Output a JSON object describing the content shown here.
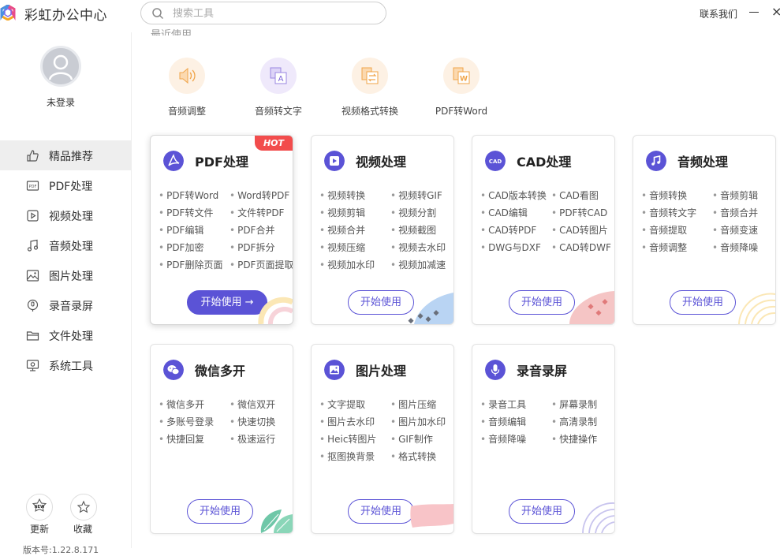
{
  "app": {
    "title": "彩虹办公中心"
  },
  "search": {
    "placeholder": "搜索工具"
  },
  "header": {
    "contact": "联系我们",
    "minimize": "—",
    "close": "×"
  },
  "user": {
    "status": "未登录"
  },
  "sidebar": {
    "items": [
      {
        "label": "精品推荐",
        "icon": "thumbs-up-icon"
      },
      {
        "label": "PDF处理",
        "icon": "pdf-icon"
      },
      {
        "label": "视频处理",
        "icon": "video-icon"
      },
      {
        "label": "音频处理",
        "icon": "music-icon"
      },
      {
        "label": "图片处理",
        "icon": "image-icon"
      },
      {
        "label": "录音录屏",
        "icon": "record-icon"
      },
      {
        "label": "文件处理",
        "icon": "folder-icon"
      },
      {
        "label": "系统工具",
        "icon": "system-icon"
      }
    ],
    "update_label": "更新",
    "favorites_label": "收藏",
    "version": "版本号:1.22.8.171"
  },
  "recent": {
    "title": "最近使用",
    "items": [
      {
        "label": "音频调整",
        "color": "#fdf1e4"
      },
      {
        "label": "音频转文字",
        "color": "#efe9fb"
      },
      {
        "label": "视频格式转换",
        "color": "#fdf1e4"
      },
      {
        "label": "PDF转Word",
        "color": "#fdf1e4"
      }
    ]
  },
  "cards": [
    {
      "title": "PDF处理",
      "hot": "HOT",
      "button": "开始使用 →",
      "features": [
        "PDF转Word",
        "Word转PDF",
        "PDF转文件",
        "文件转PDF",
        "PDF编辑",
        "PDF合并",
        "PDF加密",
        "PDF拆分",
        "PDF删除页面",
        "PDF页面提取"
      ]
    },
    {
      "title": "视频处理",
      "button": "开始使用",
      "features": [
        "视频转换",
        "视频转GIF",
        "视频剪辑",
        "视频分割",
        "视频合并",
        "视频截图",
        "视频压缩",
        "视频去水印",
        "视频加水印",
        "视频加减速"
      ]
    },
    {
      "title": "CAD处理",
      "button": "开始使用",
      "features": [
        "CAD版本转换",
        "CAD看图",
        "CAD编辑",
        "PDF转CAD",
        "CAD转PDF",
        "CAD转图片",
        "DWG与DXF",
        "CAD转DWF"
      ]
    },
    {
      "title": "音频处理",
      "button": "开始使用",
      "features": [
        "音频转换",
        "音频剪辑",
        "音频转文字",
        "音频合并",
        "音频提取",
        "音频变速",
        "音频调整",
        "音频降噪"
      ]
    },
    {
      "title": "微信多开",
      "button": "开始使用",
      "features": [
        "微信多开",
        "微信双开",
        "多账号登录",
        "快速切换",
        "快捷回复",
        "极速运行"
      ]
    },
    {
      "title": "图片处理",
      "button": "开始使用",
      "features": [
        "文字提取",
        "图片压缩",
        "图片去水印",
        "图片加水印",
        "Heic转图片",
        "GIF制作",
        "抠图换背景",
        "格式转换"
      ]
    },
    {
      "title": "录音录屏",
      "button": "开始使用",
      "features": [
        "录音工具",
        "屏幕录制",
        "音频编辑",
        "高清录制",
        "音频降噪",
        "快捷操作"
      ]
    }
  ],
  "colors": {
    "accent": "#5b53d6",
    "hot": "#f24c4c"
  }
}
